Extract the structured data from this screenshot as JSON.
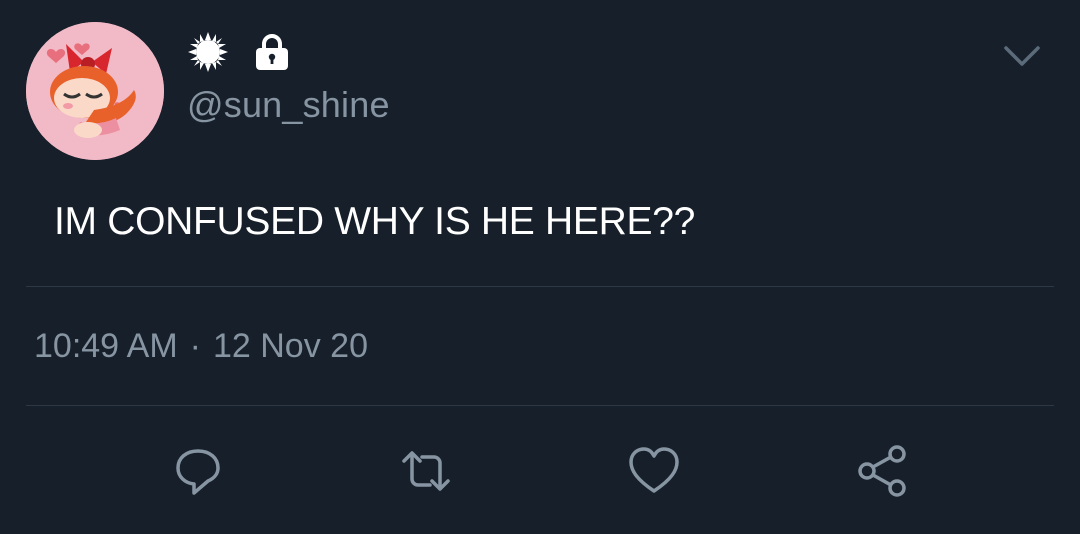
{
  "profile": {
    "handle": "@sun_shine",
    "avatar_icon": "blossom-avatar",
    "badges": [
      "sun-icon",
      "lock-icon"
    ]
  },
  "tweet": {
    "text": "IM CONFUSED WHY IS HE HERE??",
    "time": "10:49 AM",
    "separator": "·",
    "date": "12 Nov 20"
  },
  "actions": [
    "reply-icon",
    "retweet-icon",
    "like-icon",
    "share-icon"
  ],
  "colors": {
    "background": "#161f2a",
    "text_primary": "#ffffff",
    "text_secondary": "#8795a3",
    "divider": "#2c3845",
    "avatar_bg": "#f2b9c6"
  }
}
